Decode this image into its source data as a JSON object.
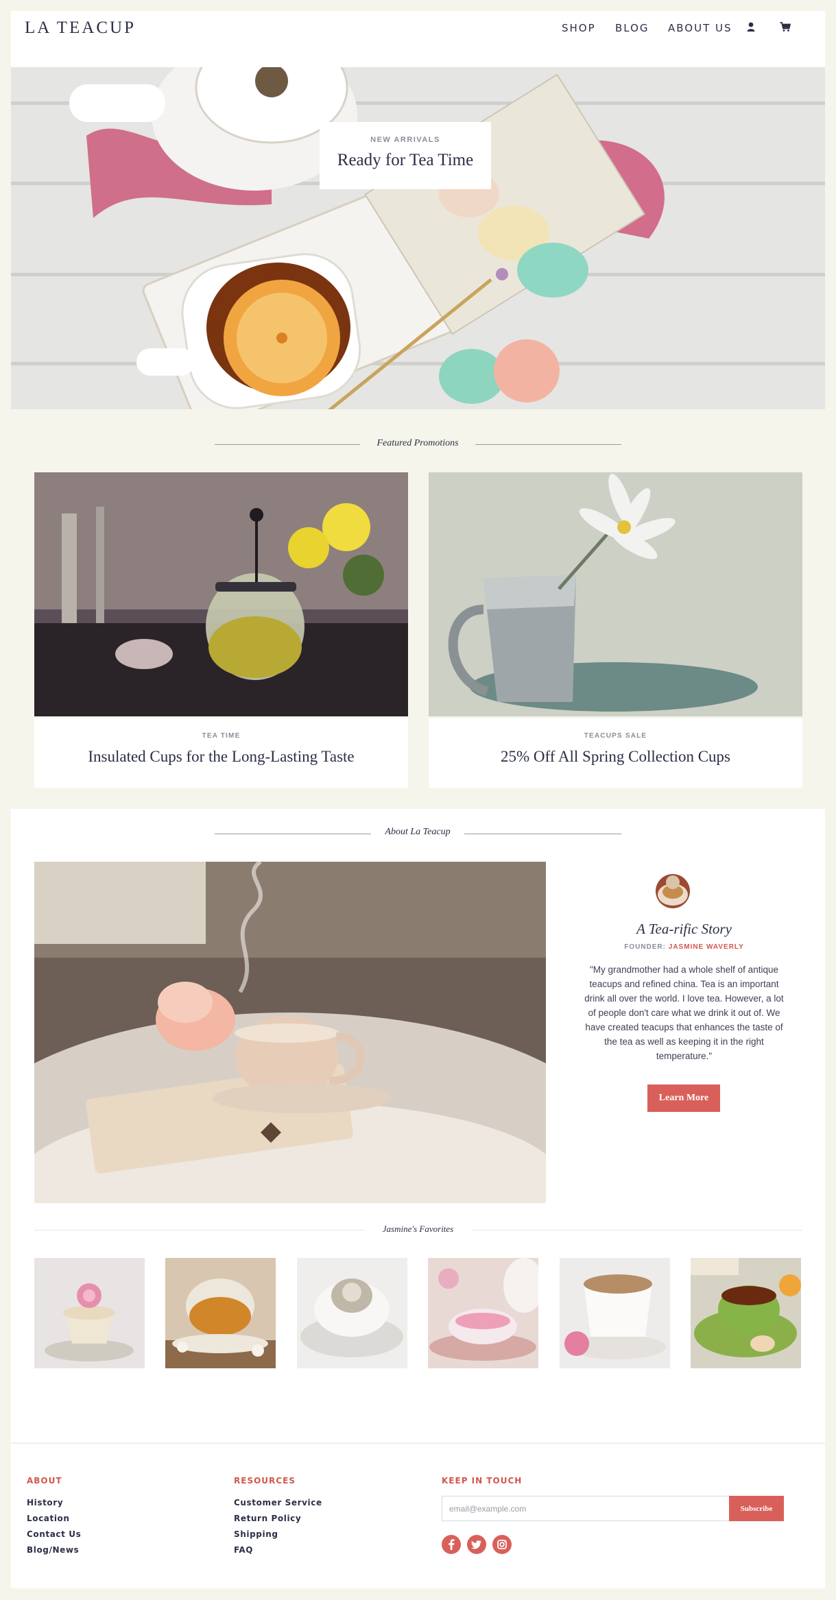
{
  "header": {
    "logo": "LA TEACUP",
    "nav": [
      {
        "label": "SHOP"
      },
      {
        "label": "BLOG"
      },
      {
        "label": "ABOUT US"
      }
    ],
    "icons": [
      "user-icon",
      "cart-icon"
    ]
  },
  "hero": {
    "eyebrow": "NEW ARRIVALS",
    "title": "Ready for Tea Time"
  },
  "featured": {
    "title": "Featured Promotions",
    "cards": [
      {
        "eyebrow": "TEA TIME",
        "title": "Insulated Cups for the Long-Lasting Taste"
      },
      {
        "eyebrow": "TEACUPS SALE",
        "title": "25% Off All Spring Collection Cups"
      }
    ]
  },
  "about": {
    "title": "About La Teacup",
    "story_title": "A Tea-rific Story",
    "founder_label": "FOUNDER:",
    "founder_name": "JASMINE WAVERLY",
    "quote": "\"My grandmother had a whole shelf of antique teacups and refined china. Tea is an important drink all over the world. I love tea. However, a lot of people don't care what we drink it out of. We have created teacups that enhances the taste of the tea as well as keeping it in the right temperature.\"",
    "cta": "Learn More",
    "favorites_title": "Jasmine's Favorites"
  },
  "footer": {
    "about": {
      "heading": "ABOUT",
      "links": [
        "History",
        "Location",
        "Contact Us",
        "Blog/News"
      ]
    },
    "resources": {
      "heading": "RESOURCES",
      "links": [
        "Customer Service",
        "Return Policy",
        "Shipping",
        "FAQ"
      ]
    },
    "contact": {
      "heading": "KEEP IN TOUCH",
      "email_placeholder": "email@example.com",
      "subscribe": "Subscribe",
      "social": [
        "facebook-icon",
        "twitter-icon",
        "instagram-icon"
      ]
    }
  },
  "colors": {
    "accent": "#d9605a",
    "navy": "#2b2f45",
    "page_bg": "#f6f5ec"
  }
}
